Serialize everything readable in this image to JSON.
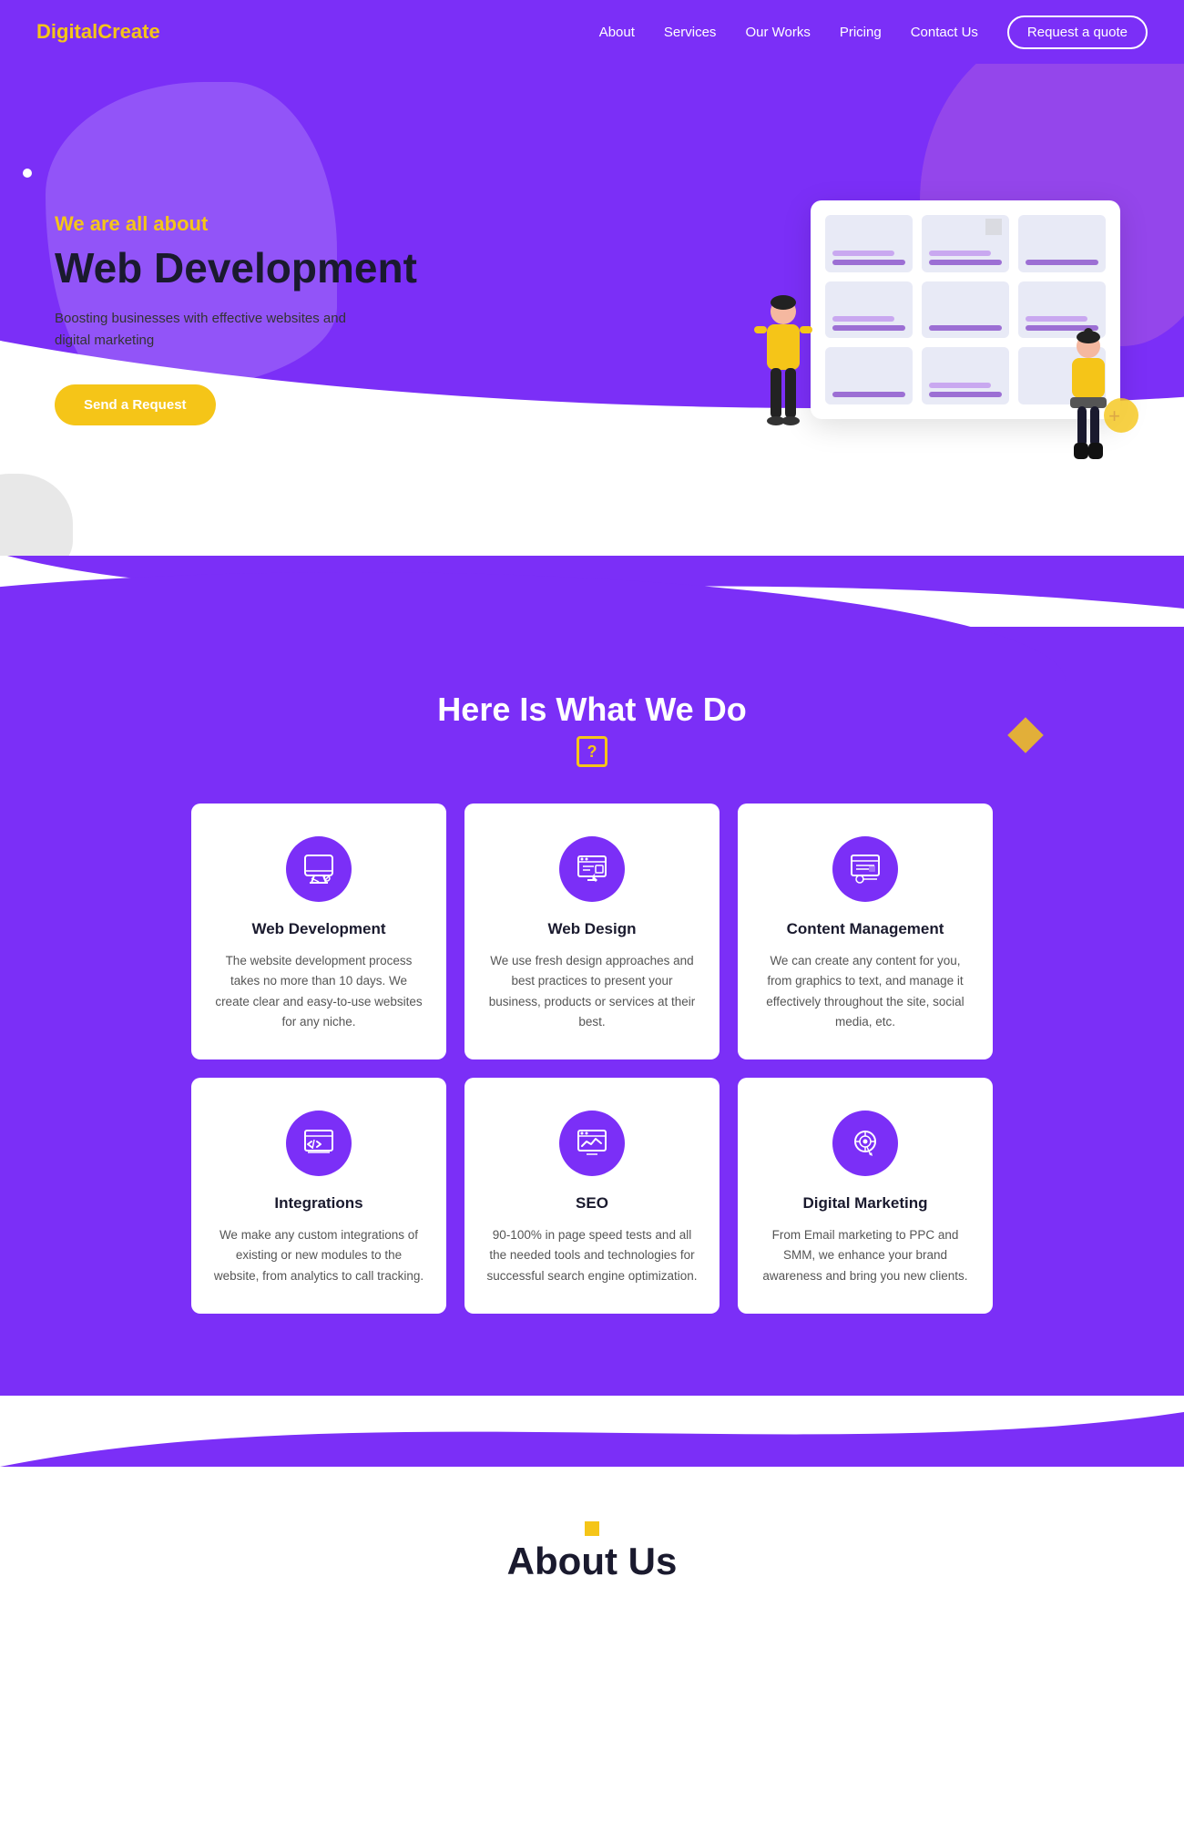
{
  "brand": {
    "name_black": "Digital",
    "name_yellow": "Create"
  },
  "nav": {
    "links": [
      {
        "label": "About",
        "href": "#about"
      },
      {
        "label": "Services",
        "href": "#services"
      },
      {
        "label": "Our Works",
        "href": "#works"
      },
      {
        "label": "Pricing",
        "href": "#pricing"
      },
      {
        "label": "Contact Us",
        "href": "#contact"
      }
    ],
    "cta_label": "Request a quote"
  },
  "hero": {
    "subtitle": "We are all about",
    "title": "Web Development",
    "description": "Boosting businesses with effective websites and digital marketing",
    "btn_label": "Send a Request"
  },
  "services_section": {
    "title": "Here Is What We Do",
    "question_icon": "?",
    "cards": [
      {
        "id": "web-dev",
        "title": "Web Development",
        "description": "The website development process takes no more than 10 days. We create clear and easy-to-use websites for any niche.",
        "icon": "monitor"
      },
      {
        "id": "web-design",
        "title": "Web Design",
        "description": "We use fresh design approaches and best practices to present your business, products or services at their best.",
        "icon": "design"
      },
      {
        "id": "content-mgmt",
        "title": "Content Management",
        "description": "We can create any content for you, from graphics to text, and manage it effectively throughout the site, social media, etc.",
        "icon": "content"
      },
      {
        "id": "integrations",
        "title": "Integrations",
        "description": "We make any custom integrations of existing or new modules to the website, from analytics to call tracking.",
        "icon": "code"
      },
      {
        "id": "seo",
        "title": "SEO",
        "description": "90-100% in page speed tests and all the needed tools and technologies for successful search engine optimization.",
        "icon": "seo"
      },
      {
        "id": "digital-marketing",
        "title": "Digital Marketing",
        "description": "From Email marketing to PPC and SMM, we enhance your brand awareness and bring you new clients.",
        "icon": "marketing"
      }
    ]
  },
  "about_teaser": {
    "heading": "About Us"
  },
  "colors": {
    "purple": "#7b2ff7",
    "yellow": "#f5c518",
    "dark": "#1a1a2e",
    "white": "#ffffff"
  }
}
